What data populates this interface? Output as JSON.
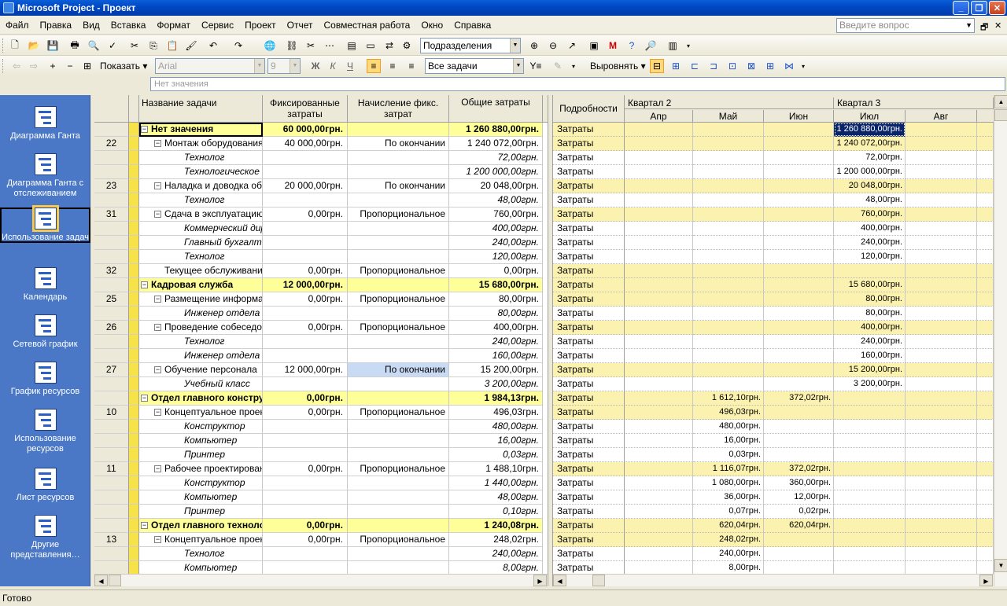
{
  "window": {
    "title": "Microsoft Project - Проект"
  },
  "menu": [
    "Файл",
    "Правка",
    "Вид",
    "Вставка",
    "Формат",
    "Сервис",
    "Проект",
    "Отчет",
    "Совместная работа",
    "Окно",
    "Справка"
  ],
  "ask": {
    "placeholder": "Введите вопрос"
  },
  "toolbar1": {
    "group_combo": "Подразделения"
  },
  "toolbar2": {
    "show_label": "Показать",
    "font": "Arial",
    "size": "9",
    "bold": "Ж",
    "italic": "К",
    "underline": "Ч",
    "filter": "Все задачи",
    "level_label": "Выровнять"
  },
  "editbar": {
    "value": "Нет значения"
  },
  "views": [
    {
      "label": "Диаграмма Ганта",
      "icon": "gantt-chart-icon"
    },
    {
      "label": "Диаграмма Ганта с отслеживанием",
      "icon": "tracking-gantt-icon"
    },
    {
      "label": "Использование задач",
      "icon": "task-usage-icon"
    },
    {
      "label": "Календарь",
      "icon": "calendar-icon"
    },
    {
      "label": "Сетевой график",
      "icon": "network-diagram-icon"
    },
    {
      "label": "График ресурсов",
      "icon": "resource-graph-icon"
    },
    {
      "label": "Использование ресурсов",
      "icon": "resource-usage-icon"
    },
    {
      "label": "Лист ресурсов",
      "icon": "resource-sheet-icon"
    },
    {
      "label": "Другие представления…",
      "icon": "more-views-icon"
    }
  ],
  "columns": {
    "name": "Название задачи",
    "fixed": "Фиксированные затраты",
    "accrual": "Начисление фикс. затрат",
    "total": "Общие затраты",
    "details": "Подробности"
  },
  "timescale": {
    "quarters": [
      "Квартал 2",
      "Квартал 3"
    ],
    "months": [
      "Апр",
      "Май",
      "Июн",
      "Июл",
      "Авг"
    ]
  },
  "rows": [
    {
      "id": "",
      "type": "group",
      "name": "Нет значения",
      "fixed": "60 000,00грн.",
      "accrual": "",
      "total": "1 260 880,00грн.",
      "det": "Затраты",
      "t": [
        "",
        "",
        "",
        "1 260 880,00грн.",
        ""
      ]
    },
    {
      "id": "22",
      "type": "task",
      "name": "Монтаж оборудования",
      "fixed": "40 000,00грн.",
      "accrual": "По окончании",
      "total": "1 240 072,00грн.",
      "det": "Затраты",
      "t": [
        "",
        "",
        "",
        "1 240 072,00грн.",
        ""
      ]
    },
    {
      "id": "",
      "type": "asg",
      "name": "Технолог",
      "fixed": "",
      "accrual": "",
      "total": "72,00грн.",
      "det": "Затраты",
      "t": [
        "",
        "",
        "",
        "72,00грн.",
        ""
      ]
    },
    {
      "id": "",
      "type": "asg",
      "name": "Технологическое о",
      "fixed": "",
      "accrual": "",
      "total": "1 200 000,00грн.",
      "det": "Затраты",
      "t": [
        "",
        "",
        "",
        "1 200 000,00грн.",
        ""
      ]
    },
    {
      "id": "23",
      "type": "task",
      "name": "Наладка и доводка обо",
      "fixed": "20 000,00грн.",
      "accrual": "По окончании",
      "total": "20 048,00грн.",
      "det": "Затраты",
      "t": [
        "",
        "",
        "",
        "20 048,00грн.",
        ""
      ]
    },
    {
      "id": "",
      "type": "asg",
      "name": "Технолог",
      "fixed": "",
      "accrual": "",
      "total": "48,00грн.",
      "det": "Затраты",
      "t": [
        "",
        "",
        "",
        "48,00грн.",
        ""
      ]
    },
    {
      "id": "31",
      "type": "task",
      "name": "Сдача в эксплуатацию",
      "fixed": "0,00грн.",
      "accrual": "Пропорциональное",
      "total": "760,00грн.",
      "det": "Затраты",
      "t": [
        "",
        "",
        "",
        "760,00грн.",
        ""
      ]
    },
    {
      "id": "",
      "type": "asg",
      "name": "Коммерческий дире",
      "fixed": "",
      "accrual": "",
      "total": "400,00грн.",
      "det": "Затраты",
      "t": [
        "",
        "",
        "",
        "400,00грн.",
        ""
      ]
    },
    {
      "id": "",
      "type": "asg",
      "name": "Главный бухгалте,",
      "fixed": "",
      "accrual": "",
      "total": "240,00грн.",
      "det": "Затраты",
      "t": [
        "",
        "",
        "",
        "240,00грн.",
        ""
      ]
    },
    {
      "id": "",
      "type": "asg",
      "name": "Технолог",
      "fixed": "",
      "accrual": "",
      "total": "120,00грн.",
      "det": "Затраты",
      "t": [
        "",
        "",
        "",
        "120,00грн.",
        ""
      ]
    },
    {
      "id": "32",
      "type": "task0",
      "name": "Текущее обслуживание",
      "fixed": "0,00грн.",
      "accrual": "Пропорциональное",
      "total": "0,00грн.",
      "det": "Затраты",
      "t": [
        "",
        "",
        "",
        "",
        ""
      ]
    },
    {
      "id": "",
      "type": "group",
      "name": "Кадровая служба",
      "fixed": "12 000,00грн.",
      "accrual": "",
      "total": "15 680,00грн.",
      "det": "Затраты",
      "t": [
        "",
        "",
        "",
        "15 680,00грн.",
        ""
      ]
    },
    {
      "id": "25",
      "type": "task",
      "name": "Размещение информац",
      "fixed": "0,00грн.",
      "accrual": "Пропорциональное",
      "total": "80,00грн.",
      "det": "Затраты",
      "t": [
        "",
        "",
        "",
        "80,00грн.",
        ""
      ]
    },
    {
      "id": "",
      "type": "asg",
      "name": "Инженер отдела к",
      "fixed": "",
      "accrual": "",
      "total": "80,00грн.",
      "det": "Затраты",
      "t": [
        "",
        "",
        "",
        "80,00грн.",
        ""
      ]
    },
    {
      "id": "26",
      "type": "task",
      "name": "Проведение собеседов",
      "fixed": "0,00грн.",
      "accrual": "Пропорциональное",
      "total": "400,00грн.",
      "det": "Затраты",
      "t": [
        "",
        "",
        "",
        "400,00грн.",
        ""
      ]
    },
    {
      "id": "",
      "type": "asg",
      "name": "Технолог",
      "fixed": "",
      "accrual": "",
      "total": "240,00грн.",
      "det": "Затраты",
      "t": [
        "",
        "",
        "",
        "240,00грн.",
        ""
      ]
    },
    {
      "id": "",
      "type": "asg",
      "name": "Инженер отдела к",
      "fixed": "",
      "accrual": "",
      "total": "160,00грн.",
      "det": "Затраты",
      "t": [
        "",
        "",
        "",
        "160,00грн.",
        ""
      ]
    },
    {
      "id": "27",
      "type": "task",
      "name": "Обучение персонала",
      "fixed": "12 000,00грн.",
      "accrual": "По окончании",
      "total": "15 200,00грн.",
      "det": "Затраты",
      "t": [
        "",
        "",
        "",
        "15 200,00грн.",
        ""
      ]
    },
    {
      "id": "",
      "type": "asg",
      "name": "Учебный класс",
      "fixed": "",
      "accrual": "",
      "total": "3 200,00грн.",
      "det": "Затраты",
      "t": [
        "",
        "",
        "",
        "3 200,00грн.",
        ""
      ]
    },
    {
      "id": "",
      "type": "group",
      "name": "Отдел главного конструкто",
      "fixed": "0,00грн.",
      "accrual": "",
      "total": "1 984,13грн.",
      "det": "Затраты",
      "t": [
        "",
        "1 612,10грн.",
        "372,02грн.",
        "",
        ""
      ]
    },
    {
      "id": "10",
      "type": "task",
      "name": "Концептуальное проект",
      "fixed": "0,00грн.",
      "accrual": "Пропорциональное",
      "total": "496,03грн.",
      "det": "Затраты",
      "t": [
        "",
        "496,03грн.",
        "",
        "",
        ""
      ]
    },
    {
      "id": "",
      "type": "asg",
      "name": "Конструктор",
      "fixed": "",
      "accrual": "",
      "total": "480,00грн.",
      "det": "Затраты",
      "t": [
        "",
        "480,00грн.",
        "",
        "",
        ""
      ]
    },
    {
      "id": "",
      "type": "asg",
      "name": "Компьютер",
      "fixed": "",
      "accrual": "",
      "total": "16,00грн.",
      "det": "Затраты",
      "t": [
        "",
        "16,00грн.",
        "",
        "",
        ""
      ]
    },
    {
      "id": "",
      "type": "asg",
      "name": "Принтер",
      "fixed": "",
      "accrual": "",
      "total": "0,03грн.",
      "det": "Затраты",
      "t": [
        "",
        "0,03грн.",
        "",
        "",
        ""
      ]
    },
    {
      "id": "11",
      "type": "task",
      "name": "Рабочее проектировани",
      "fixed": "0,00грн.",
      "accrual": "Пропорциональное",
      "total": "1 488,10грн.",
      "det": "Затраты",
      "t": [
        "",
        "1 116,07грн.",
        "372,02грн.",
        "",
        ""
      ]
    },
    {
      "id": "",
      "type": "asg",
      "name": "Конструктор",
      "fixed": "",
      "accrual": "",
      "total": "1 440,00грн.",
      "det": "Затраты",
      "t": [
        "",
        "1 080,00грн.",
        "360,00грн.",
        "",
        ""
      ]
    },
    {
      "id": "",
      "type": "asg",
      "name": "Компьютер",
      "fixed": "",
      "accrual": "",
      "total": "48,00грн.",
      "det": "Затраты",
      "t": [
        "",
        "36,00грн.",
        "12,00грн.",
        "",
        ""
      ]
    },
    {
      "id": "",
      "type": "asg",
      "name": "Принтер",
      "fixed": "",
      "accrual": "",
      "total": "0,10грн.",
      "det": "Затраты",
      "t": [
        "",
        "0,07грн.",
        "0,02грн.",
        "",
        ""
      ]
    },
    {
      "id": "",
      "type": "group",
      "name": "Отдел главного технолога",
      "fixed": "0,00грн.",
      "accrual": "",
      "total": "1 240,08грн.",
      "det": "Затраты",
      "t": [
        "",
        "620,04грн.",
        "620,04грн.",
        "",
        ""
      ]
    },
    {
      "id": "13",
      "type": "task",
      "name": "Концептуальное проект",
      "fixed": "0,00грн.",
      "accrual": "Пропорциональное",
      "total": "248,02грн.",
      "det": "Затраты",
      "t": [
        "",
        "248,02грн.",
        "",
        "",
        ""
      ]
    },
    {
      "id": "",
      "type": "asg",
      "name": "Технолог",
      "fixed": "",
      "accrual": "",
      "total": "240,00грн.",
      "det": "Затраты",
      "t": [
        "",
        "240,00грн.",
        "",
        "",
        ""
      ]
    },
    {
      "id": "",
      "type": "asg",
      "name": "Компьютер",
      "fixed": "",
      "accrual": "",
      "total": "8,00грн.",
      "det": "Затраты",
      "t": [
        "",
        "8,00грн.",
        "",
        "",
        ""
      ]
    }
  ],
  "status": {
    "text": "Готово"
  }
}
